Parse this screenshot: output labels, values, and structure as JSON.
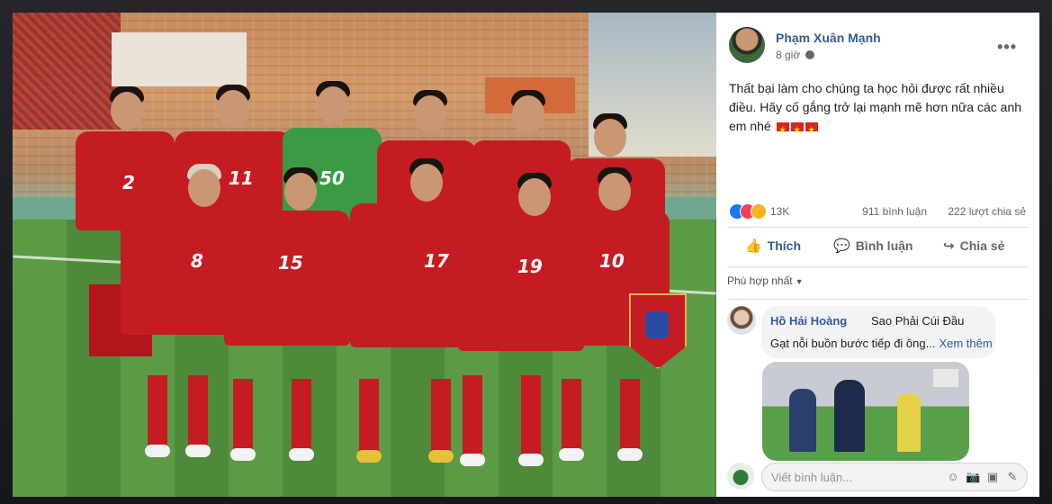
{
  "post": {
    "author": "Phạm Xuân Mạnh",
    "time": "8 giờ",
    "more": "•••",
    "text": "Thất bại làm cho chúng ta học hỏi được rất nhiều điều. Hãy cố gắng trở lại mạnh mẽ hơn nữa các anh em nhé"
  },
  "stats": {
    "reactions": "13K",
    "comments": "911 bình luận",
    "shares": "222 lượt chia sẻ"
  },
  "actions": {
    "like": "Thích",
    "comment": "Bình luận",
    "share": "Chia sẻ"
  },
  "sort": {
    "label": "Phù hợp nhất"
  },
  "comment": {
    "name": "Hồ Hải Hoàng",
    "text_line1": "Sao Phải Cúi Đầu",
    "text_line2": "Gạt nỗi buồn bước tiếp đi ông...",
    "see_more": "Xem thêm"
  },
  "compose": {
    "placeholder": "Viết bình luận..."
  },
  "jersey_numbers": [
    "2",
    "11",
    "50",
    "8",
    "15",
    "17",
    "19",
    "10"
  ],
  "colors": {
    "link_blue": "#385898",
    "kit_red": "#c41c22"
  }
}
